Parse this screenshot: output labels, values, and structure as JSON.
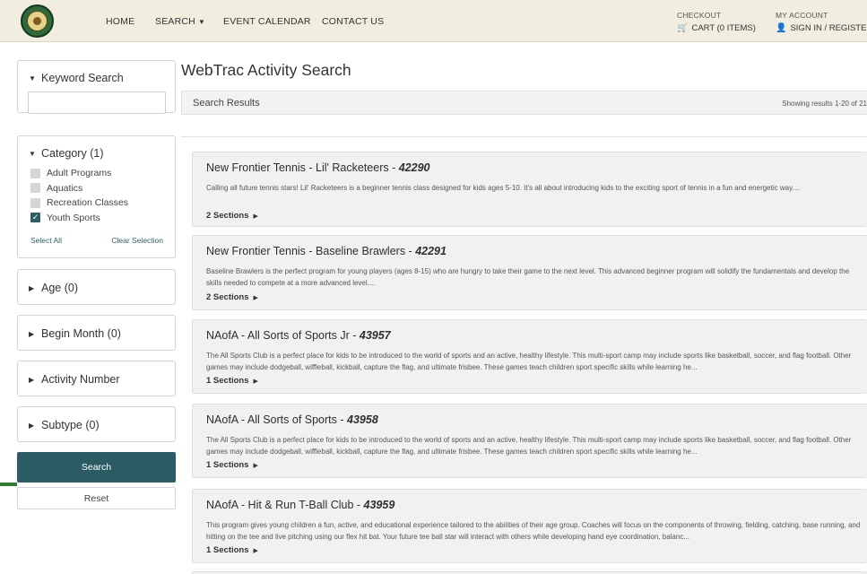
{
  "nav": {
    "items": [
      "HOME",
      "SEARCH",
      "EVENT CALENDAR",
      "CONTACT US"
    ],
    "search_caret": "▼",
    "checkout_label": "CHECKOUT",
    "cart_link": "CART (0 ITEMS)",
    "account_label": "MY ACCOUNT",
    "signin_link": "SIGN IN / REGISTER"
  },
  "sidebar": {
    "keyword": {
      "title": "Keyword Search",
      "value": ""
    },
    "category": {
      "title": "Category",
      "count": "(1)",
      "items": [
        {
          "label": "Adult Programs",
          "checked": false
        },
        {
          "label": "Aquatics",
          "checked": false
        },
        {
          "label": "Recreation Classes",
          "checked": false
        },
        {
          "label": "Youth Sports",
          "checked": true
        }
      ],
      "select_all": "Select All",
      "clear_selection": "Clear Selection"
    },
    "filters": [
      {
        "title": "Age",
        "count": "(0)"
      },
      {
        "title": "Begin Month",
        "count": "(0)"
      },
      {
        "title": "Activity Number",
        "count": ""
      },
      {
        "title": "Subtype",
        "count": "(0)"
      }
    ],
    "search_button": "Search",
    "reset_button": "Reset"
  },
  "main": {
    "title": "WebTrac Activity Search",
    "results_label": "Search Results",
    "results_count": "Showing results 1-20 of 21",
    "activities": [
      {
        "title": "New Frontier Tennis - Lil' Racketeers - ",
        "number": "42290",
        "description": "Calling all future tennis stars! Lil' Racketeers is a beginner tennis class designed for kids ages 5-10. It's all about introducing kids to the exciting sport of tennis in a fun and energetic way....",
        "sections": "2 Sections"
      },
      {
        "title": "New Frontier Tennis - Baseline Brawlers - ",
        "number": "42291",
        "description": "Baseline Brawlers is the perfect program for young players (ages 8-15) who are hungry to take their game to the next level. This advanced beginner program will solidify the fundamentals and develop the skills needed to compete at a more advanced level....",
        "sections": "2 Sections"
      },
      {
        "title": "NAofA - All Sorts of Sports Jr - ",
        "number": "43957",
        "description": "The All Sports Club is a perfect place for kids to be introduced to the world of sports and an active, healthy lifestyle. This multi-sport camp may include sports like basketball, soccer, and flag football. Other games may include dodgeball, wiffleball, kickball, capture the flag, and ultimate frisbee. These games teach children sport specific skills while learning he...",
        "sections": "1 Sections"
      },
      {
        "title": "NAofA - All Sorts of Sports - ",
        "number": "43958",
        "description": "The All Sports Club is a perfect place for kids to be introduced to the world of sports and an active, healthy lifestyle. This multi-sport camp may include sports like basketball, soccer, and flag football. Other games may include dodgeball, wiffleball, kickball, capture the flag, and ultimate frisbee. These games teach children sport specific skills while learning he...",
        "sections": "1 Sections"
      },
      {
        "title": "NAofA - Hit & Run T-Ball Club - ",
        "number": "43959",
        "description": "This program gives young children a fun, active, and educational experience tailored to the abilities of their age group. Coaches will focus on the components of throwing, fielding, catching, base running, and hitting on the tee and live pitching using our flex hit bat. Your future tee ball star will interact with others while developing hand eye coordination, balanc...",
        "sections": "1 Sections"
      }
    ]
  },
  "colors": {
    "topbar": "#f1eedf",
    "accent": "#2b5b63",
    "card": "#f1f1f1"
  }
}
